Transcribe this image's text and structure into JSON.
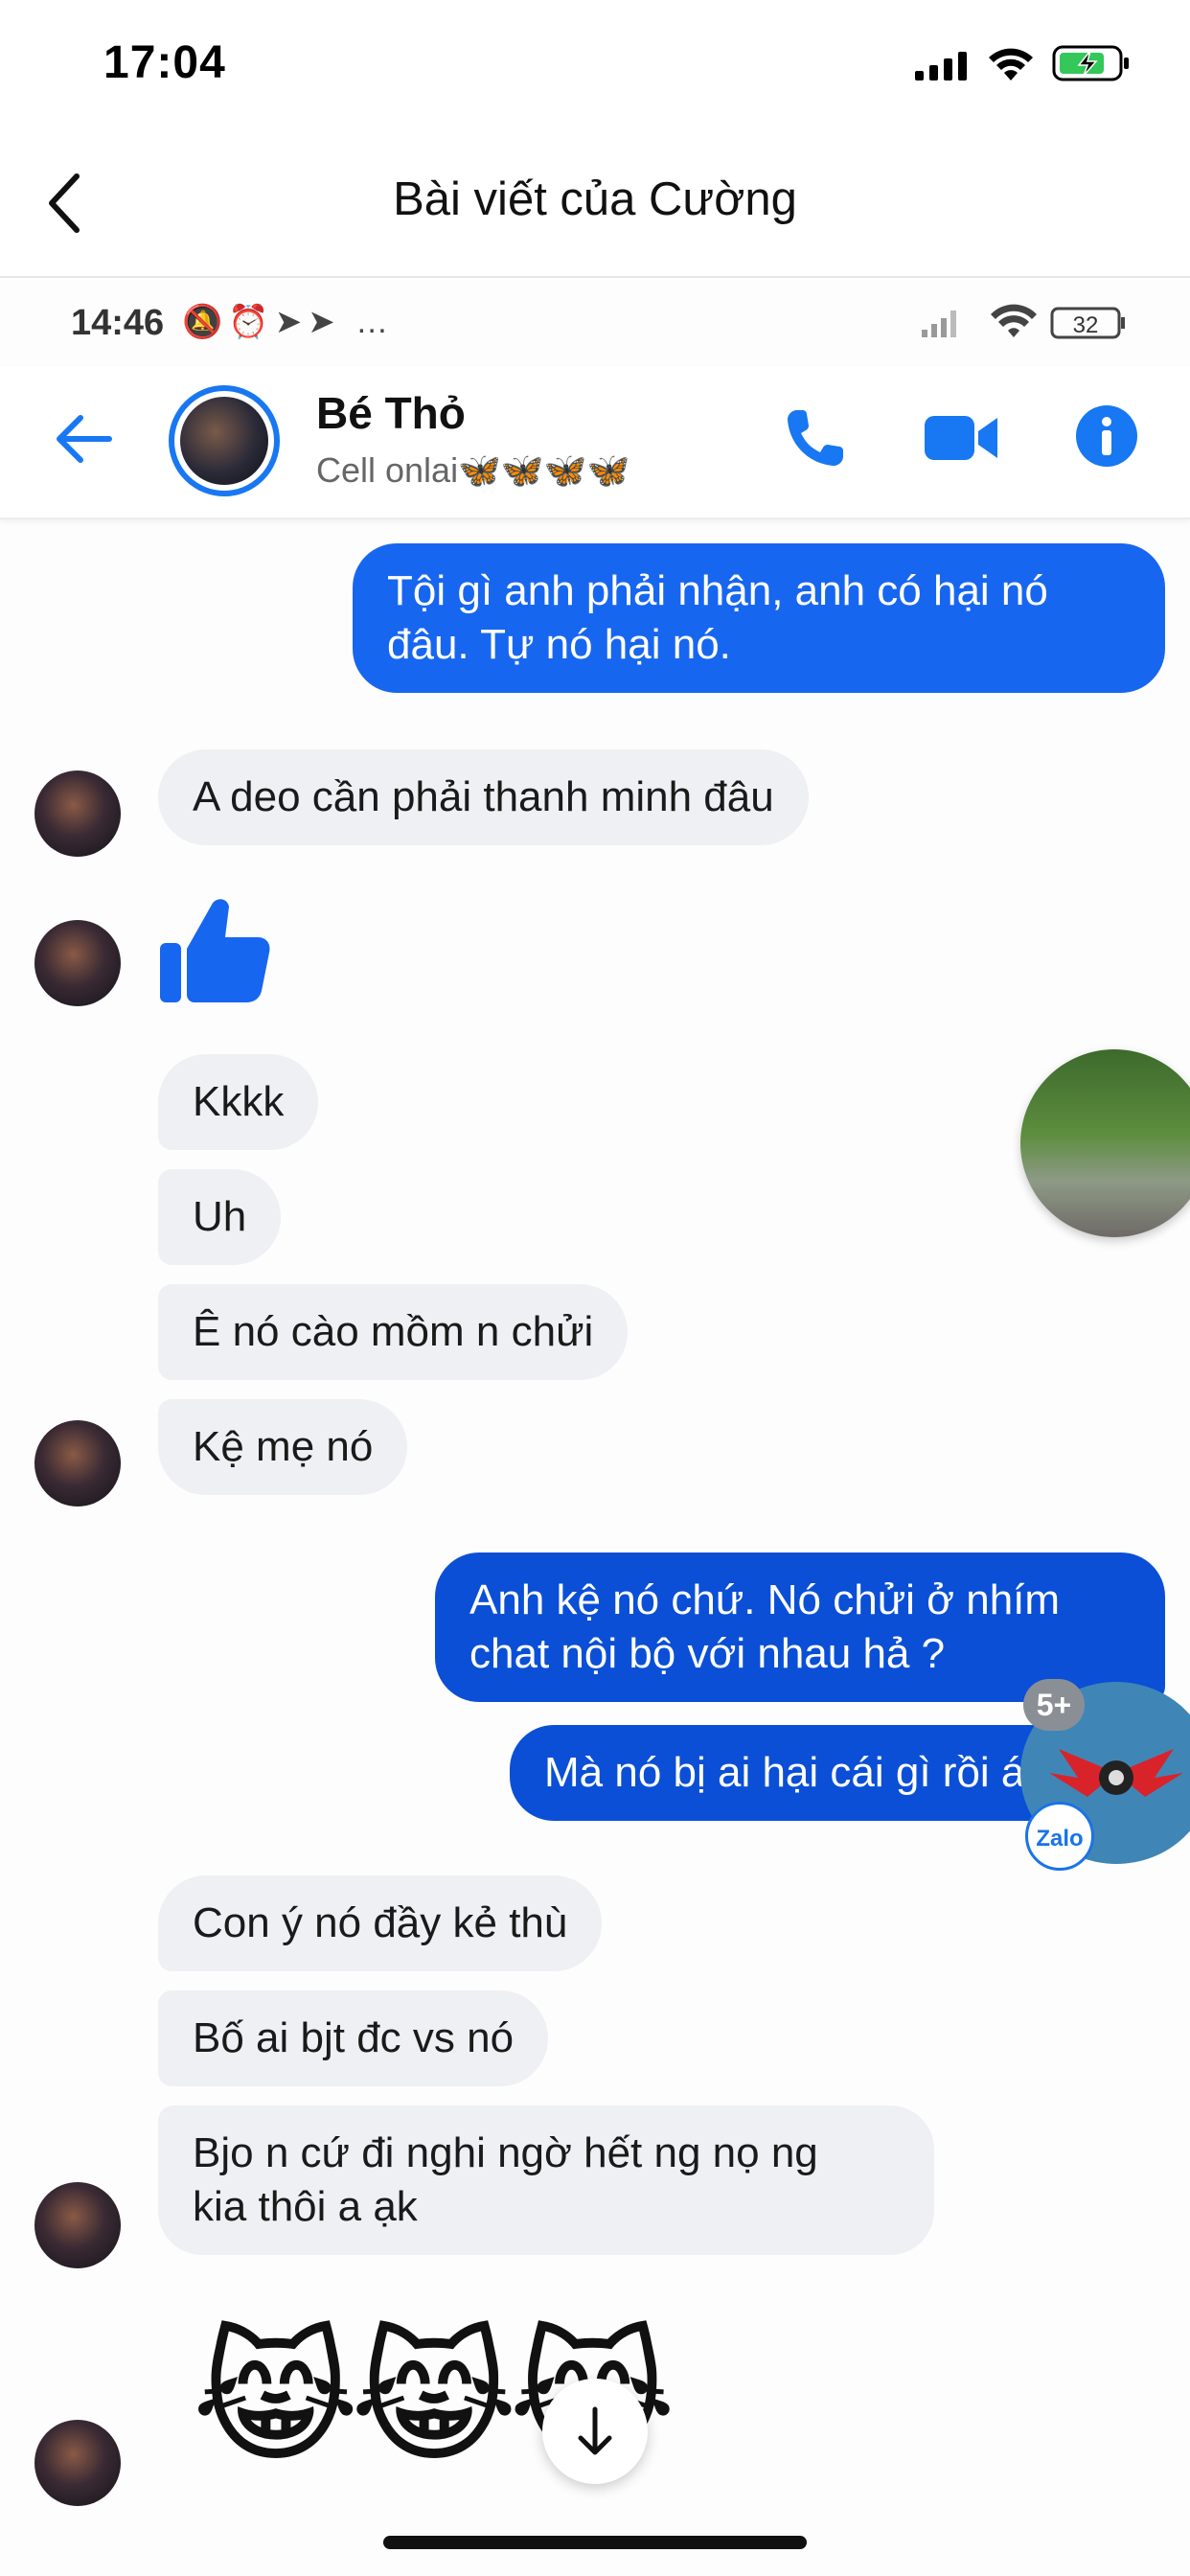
{
  "ios_status": {
    "time": "17:04"
  },
  "outer_nav": {
    "title": "Bài viết của Cường"
  },
  "inner_status": {
    "time": "14:46",
    "icons_text": "…",
    "battery": "32"
  },
  "chat_header": {
    "name": "Bé Thỏ",
    "status": "Cell onlai🦋🦋🦋🦋"
  },
  "messages": [
    {
      "side": "out",
      "text_line1": "Tội gì anh phải nhận, anh có hại nó",
      "text_line2": "đâu. Tự nó hại nó."
    },
    {
      "side": "in",
      "text": "A deo cần phải thanh minh đâu"
    },
    {
      "side": "in",
      "type": "like"
    },
    {
      "side": "in",
      "text": "Kkkk"
    },
    {
      "side": "in",
      "text": "Uh"
    },
    {
      "side": "in",
      "text": "Ê nó cào mồm n chửi"
    },
    {
      "side": "in",
      "text": "Kệ mẹ nó"
    },
    {
      "side": "out",
      "text_line1": "Anh kệ nó chứ. Nó chửi ở nhím",
      "text_line2": "chat nội bộ với nhau hả ?"
    },
    {
      "side": "out",
      "text": "Mà nó bị ai hại cái gì rồi á ?"
    },
    {
      "side": "in",
      "text": "Con ý nó đầy kẻ thù"
    },
    {
      "side": "in",
      "text": "Bố ai bjt đc vs nó"
    },
    {
      "side": "in",
      "text_line1": "Bjo n cứ đi nghi ngờ hết ng nọ ng",
      "text_line2": "kia thôi a ạk"
    },
    {
      "side": "in",
      "type": "emoji",
      "text": "😹😹😹"
    }
  ],
  "chat_heads": {
    "badge": "5+",
    "zalo_label": "Zalo"
  },
  "colors": {
    "messenger_blue": "#1766f0",
    "incoming_bg": "#eff0f3",
    "accent": "#1877f2"
  }
}
